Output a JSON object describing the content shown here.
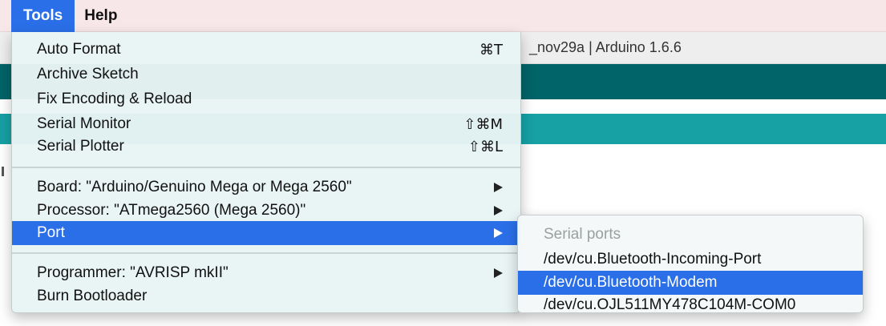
{
  "menubar": {
    "items": [
      {
        "label": "Tools",
        "active": true
      },
      {
        "label": "Help",
        "active": false
      }
    ]
  },
  "window": {
    "title": "_nov29a | Arduino 1.6.6",
    "colors": {
      "toolbar_dark": "#006468",
      "tab_bar": "#17a1a5",
      "highlight": "#2b6fe8"
    }
  },
  "tools_menu": {
    "items": [
      {
        "label": "Auto Format",
        "shortcut": "⌘T"
      },
      {
        "label": "Archive Sketch"
      },
      {
        "label": "Fix Encoding & Reload"
      },
      {
        "label": "Serial Monitor",
        "shortcut": "⇧⌘M"
      },
      {
        "label": "Serial Plotter",
        "shortcut": "⇧⌘L"
      },
      {
        "label": "Board: \"Arduino/Genuino Mega or Mega 2560\"",
        "submenu": true
      },
      {
        "label": "Processor: \"ATmega2560 (Mega 2560)\"",
        "submenu": true
      },
      {
        "label": "Port",
        "submenu": true,
        "highlighted": true
      },
      {
        "label": "Programmer: \"AVRISP mkII\"",
        "submenu": true
      },
      {
        "label": "Burn Bootloader"
      }
    ]
  },
  "port_submenu": {
    "header": "Serial ports",
    "items": [
      {
        "label": "/dev/cu.Bluetooth-Incoming-Port"
      },
      {
        "label": "/dev/cu.Bluetooth-Modem",
        "highlighted": true
      },
      {
        "label": "/dev/cu.OJL511MY478C104M-COM0"
      }
    ]
  }
}
